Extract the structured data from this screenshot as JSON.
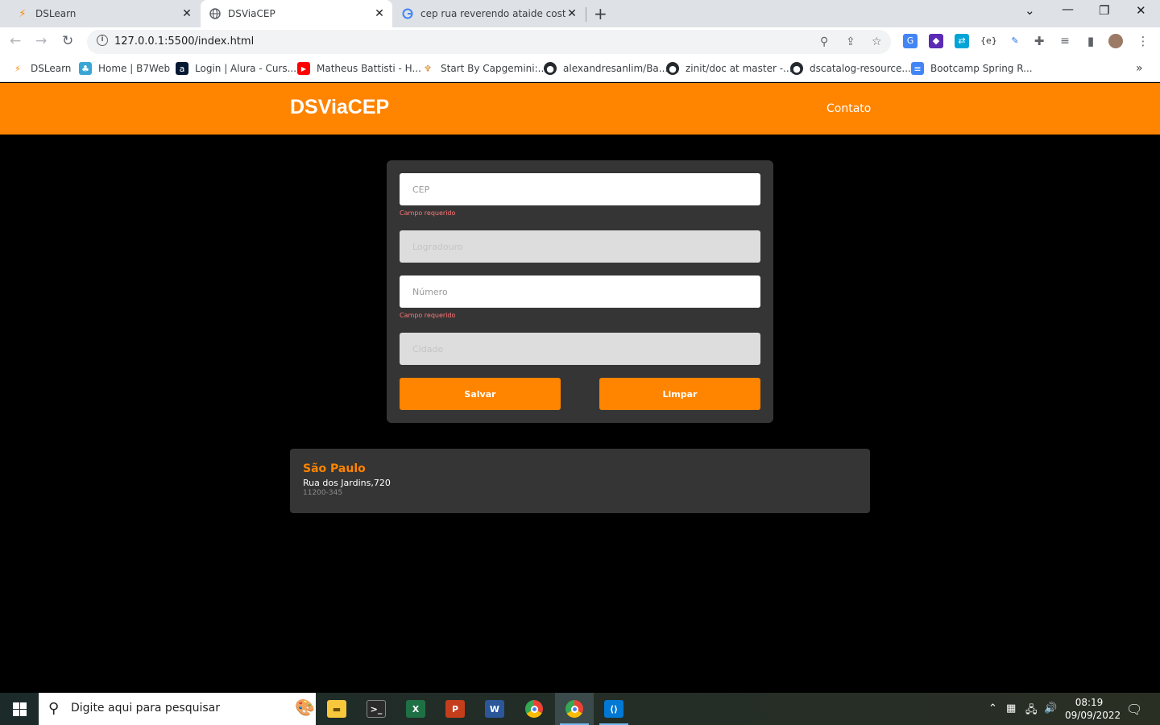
{
  "browser": {
    "tabs": [
      {
        "title": "DSLearn",
        "icon": "lightning-icon",
        "active": false
      },
      {
        "title": "DSViaCEP",
        "icon": "globe-icon",
        "active": true
      },
      {
        "title": "cep rua reverendo ataide costa -",
        "icon": "google-icon",
        "active": false
      }
    ],
    "url": "127.0.0.1:5500/index.html",
    "bookmarks": [
      {
        "label": "DSLearn",
        "icon": "lightning-icon"
      },
      {
        "label": "Home | B7Web",
        "icon": "b7web-icon"
      },
      {
        "label": "Login | Alura - Curs...",
        "icon": "alura-icon"
      },
      {
        "label": "Matheus Battisti - H...",
        "icon": "youtube-icon"
      },
      {
        "label": "Start By Capgemini:...",
        "icon": "capgemini-icon"
      },
      {
        "label": "alexandresanlim/Ba...",
        "icon": "github-icon"
      },
      {
        "label": "zinit/doc at master -...",
        "icon": "github-icon"
      },
      {
        "label": "dscatalog-resource...",
        "icon": "github-icon"
      },
      {
        "label": "Bootcamp Spring R...",
        "icon": "docs-icon"
      }
    ]
  },
  "app": {
    "brand": "DSViaCEP",
    "nav_contact": "Contato",
    "accent_color": "#ff8400",
    "form": {
      "cep_placeholder": "CEP",
      "cep_error": "Campo requerido",
      "logradouro_placeholder": "Logradouro",
      "numero_placeholder": "Número",
      "numero_error": "Campo requerido",
      "cidade_placeholder": "Cidade",
      "save_label": "Salvar",
      "clear_label": "Limpar"
    },
    "address_card": {
      "city": "São Paulo",
      "street": "Rua dos Jardins,720",
      "cep": "11200-345"
    }
  },
  "taskbar": {
    "search_placeholder": "Digite aqui para pesquisar",
    "time": "08:19",
    "date": "09/09/2022"
  }
}
